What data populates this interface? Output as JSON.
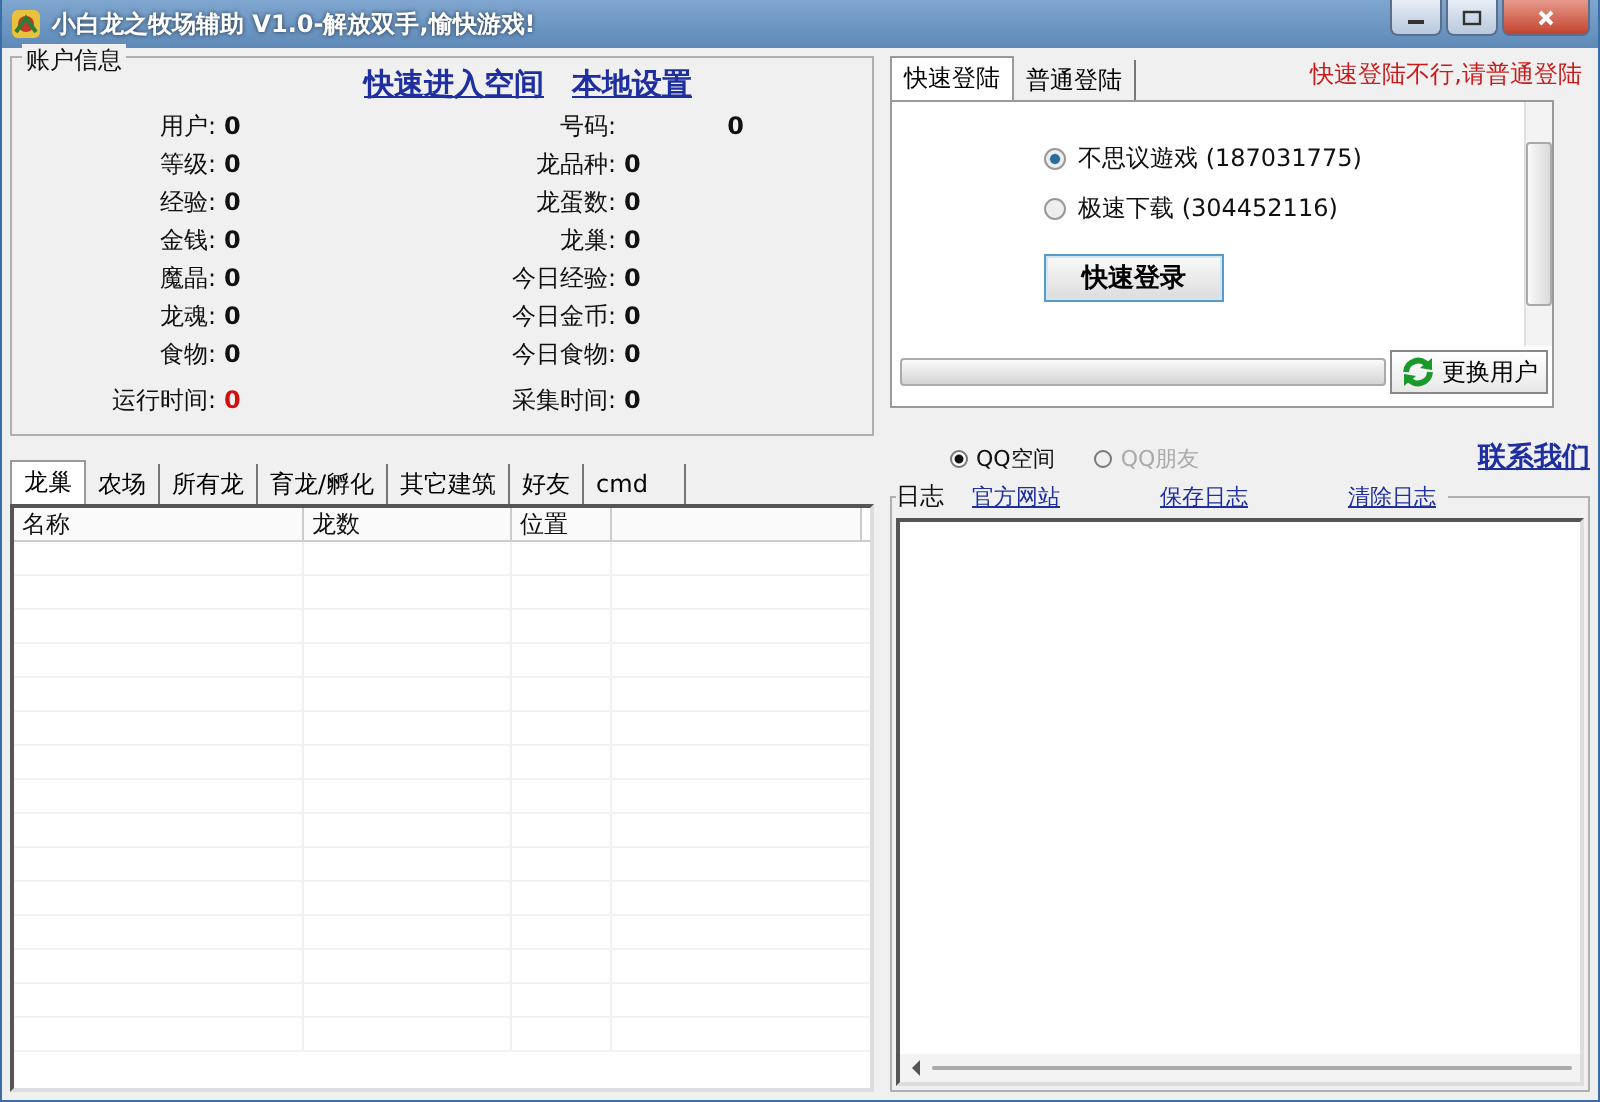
{
  "window": {
    "title": "小白龙之牧场辅助 V1.0-解放双手,愉快游戏!"
  },
  "account": {
    "title": "账户信息",
    "links": [
      "快速进入空间",
      "本地设置"
    ],
    "left_fields": [
      {
        "label": "用户:",
        "value": "0",
        "warning": false
      },
      {
        "label": "等级:",
        "value": "0",
        "warning": false
      },
      {
        "label": "经验:",
        "value": "0",
        "warning": false
      },
      {
        "label": "金钱:",
        "value": "0",
        "warning": false
      },
      {
        "label": "魔晶:",
        "value": "0",
        "warning": false
      },
      {
        "label": "龙魂:",
        "value": "0",
        "warning": false
      },
      {
        "label": "食物:",
        "value": "0",
        "warning": false
      },
      {
        "label": "运行时间:",
        "value": "0",
        "warning": true
      }
    ],
    "right_fields": [
      {
        "label": "号码:",
        "value": "0",
        "warning": false
      },
      {
        "label": "龙品种:",
        "value": "0",
        "warning": false
      },
      {
        "label": "龙蛋数:",
        "value": "0",
        "warning": false
      },
      {
        "label": "龙巢:",
        "value": "0",
        "warning": false
      },
      {
        "label": "今日经验:",
        "value": "0",
        "warning": false
      },
      {
        "label": "今日金币:",
        "value": "0",
        "warning": false
      },
      {
        "label": "今日食物:",
        "value": "0",
        "warning": false
      },
      {
        "label": "采集时间:",
        "value": "0",
        "warning": false
      }
    ]
  },
  "building_tabs": [
    {
      "label": "龙巢",
      "selected": true
    },
    {
      "label": "农场",
      "selected": false
    },
    {
      "label": "所有龙",
      "selected": false
    },
    {
      "label": "育龙/孵化",
      "selected": false
    },
    {
      "label": "其它建筑",
      "selected": false
    },
    {
      "label": "好友",
      "selected": false
    },
    {
      "label": "cmd",
      "selected": false
    }
  ],
  "table": {
    "columns": [
      "名称",
      "龙数",
      "位置"
    ]
  },
  "login": {
    "tabs": [
      {
        "label": "快速登陆",
        "selected": true
      },
      {
        "label": "普通登陆",
        "selected": false
      }
    ],
    "notice": "快速登陆不行,请普通登陆",
    "accounts": [
      {
        "label": "不思议遊戏 (187031775)",
        "selected": true
      },
      {
        "label": "极速下载 (304452116)",
        "selected": false
      }
    ],
    "login_button": "快速登录",
    "switch_button": "更换用户"
  },
  "targets": [
    {
      "label": "QQ空间",
      "selected": true,
      "disabled": false
    },
    {
      "label": "QQ朋友",
      "selected": false,
      "disabled": true
    }
  ],
  "contact_link": "联系我们",
  "log": {
    "title": "日志",
    "links": [
      "官方网站",
      "保存日志",
      "清除日志"
    ]
  }
}
